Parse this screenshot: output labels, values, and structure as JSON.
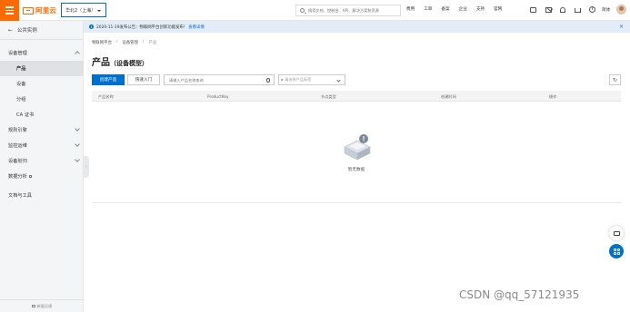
{
  "header": {
    "logo_text": "阿里云",
    "region": "华北2（上海）",
    "search_placeholder": "搜索文档、控制台、API、解决方案和资源",
    "nav_links": [
      "费用",
      "工单",
      "备案",
      "企业",
      "支持",
      "官网"
    ],
    "lang": "简体",
    "icons": [
      "screen-icon",
      "mail-icon",
      "bell-icon",
      "cart-icon",
      "help-icon"
    ]
  },
  "sidebar": {
    "back_label": "公共实例",
    "items": [
      {
        "label": "设备管理",
        "expanded": true
      },
      {
        "label": "产品",
        "active": true
      },
      {
        "label": "设备"
      },
      {
        "label": "分组"
      },
      {
        "label": "CA 证书"
      },
      {
        "label": "规则引擎"
      },
      {
        "label": "监控运维"
      },
      {
        "label": "设备划归"
      },
      {
        "label": "数据分析"
      },
      {
        "label": "文档与工具"
      }
    ],
    "footer": "新版反馈"
  },
  "notice": {
    "text": "2020-11-19发布公告：物联网平台创新功能发布！",
    "link": "查看详情"
  },
  "breadcrumb": [
    "物联网平台",
    "设备管理",
    "产品"
  ],
  "page": {
    "title": "产品",
    "subtitle": "（设备模型）"
  },
  "toolbar": {
    "create_label": "创建产品",
    "quick_label": "快速入门",
    "search_placeholder": "请输入产品名称查询",
    "node_select_placeholder": "请选择产品标签"
  },
  "table": {
    "columns": [
      "产品名称",
      "ProductKey",
      "节点类型",
      "创建时间",
      "操作"
    ],
    "empty_text": "暂无数据"
  },
  "watermark": "CSDN @qq_57121935",
  "colors": {
    "brand": "#ff6a00",
    "primary": "#0070cc"
  }
}
